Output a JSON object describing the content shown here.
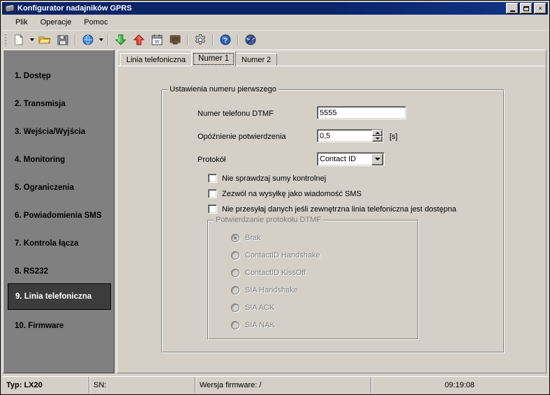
{
  "window": {
    "title": "Konfigurator nadajników GPRS",
    "icon": "chip-icon",
    "controls": {
      "minimize": "minimize-button",
      "maximize": "maximize-button",
      "close": "close-button",
      "close_glyph": "×"
    }
  },
  "menu": {
    "items": [
      {
        "label": "Plik"
      },
      {
        "label": "Operacje"
      },
      {
        "label": "Pomoc"
      }
    ]
  },
  "toolbar": {
    "buttons": [
      {
        "name": "new-file-icon",
        "has_dropdown": true
      },
      {
        "name": "open-folder-icon",
        "has_dropdown": false
      },
      {
        "name": "save-disk-icon",
        "has_dropdown": false
      },
      {
        "name": "globe-icon",
        "has_dropdown": true
      },
      {
        "name": "download-arrow-icon",
        "has_dropdown": false
      },
      {
        "name": "upload-arrow-icon",
        "has_dropdown": false
      },
      {
        "name": "calendar-icon",
        "has_dropdown": false
      },
      {
        "name": "monitor-icon",
        "has_dropdown": false
      },
      {
        "name": "gear-icon",
        "has_dropdown": false
      },
      {
        "name": "help-icon",
        "has_dropdown": false
      },
      {
        "name": "exit-icon",
        "has_dropdown": false
      }
    ]
  },
  "sidebar": {
    "items": [
      {
        "label": "1. Dostęp",
        "selected": false
      },
      {
        "label": "2. Transmisja",
        "selected": false
      },
      {
        "label": "3. Wejścia/Wyjścia",
        "selected": false
      },
      {
        "label": "4. Monitoring",
        "selected": false
      },
      {
        "label": "5. Ograniczenia",
        "selected": false
      },
      {
        "label": "6. Powiadomienia SMS",
        "selected": false
      },
      {
        "label": "7. Kontrola łącza",
        "selected": false
      },
      {
        "label": "8. RS232",
        "selected": false
      },
      {
        "label": "9. Linia telefoniczna",
        "selected": true
      },
      {
        "label": "10. Firmware",
        "selected": false
      }
    ]
  },
  "tabs": [
    {
      "label": "Linia telefoniczna",
      "active": false
    },
    {
      "label": "Numer 1",
      "active": true
    },
    {
      "label": "Numer 2",
      "active": false
    }
  ],
  "form": {
    "group_title": "Ustawienia numeru pierwszego",
    "phone": {
      "label": "Numer telefonu DTMF",
      "value": "5555"
    },
    "delay": {
      "label": "Opóźnienie potwierdzenia",
      "value": "0,5",
      "unit": "[s]"
    },
    "protocol": {
      "label": "Protokół",
      "value": "Contact ID"
    },
    "checkboxes": [
      {
        "label": "Nie sprawdzaj sumy kontrolnej",
        "checked": false
      },
      {
        "label": "Zezwól na wysyłkę jako wiadomość SMS",
        "checked": false
      },
      {
        "label": "Nie przesyłaj danych jeśli zewnętrzna linia telefoniczna jest dostępna",
        "checked": false
      }
    ],
    "dtmf_group": {
      "title": "Potwierdzanie protokołu DTMF",
      "disabled": true,
      "options": [
        {
          "label": "Brak",
          "selected": true
        },
        {
          "label": "ContactID Handshake",
          "selected": false
        },
        {
          "label": "ContactID KissOff",
          "selected": false
        },
        {
          "label": "SIA Handshake",
          "selected": false
        },
        {
          "label": "SIA ACK",
          "selected": false
        },
        {
          "label": "SIA NAK",
          "selected": false
        }
      ]
    }
  },
  "statusbar": {
    "type": "Typ: LX20",
    "sn": "SN:",
    "firmware": "Wersja firmware: /",
    "time": "09:19:08"
  },
  "colors": {
    "titlebar": "#0a246a",
    "face": "#d4d0c8",
    "sidebar": "#808080",
    "selected_item": "#3c3c3c",
    "disabled_text": "#808080"
  }
}
